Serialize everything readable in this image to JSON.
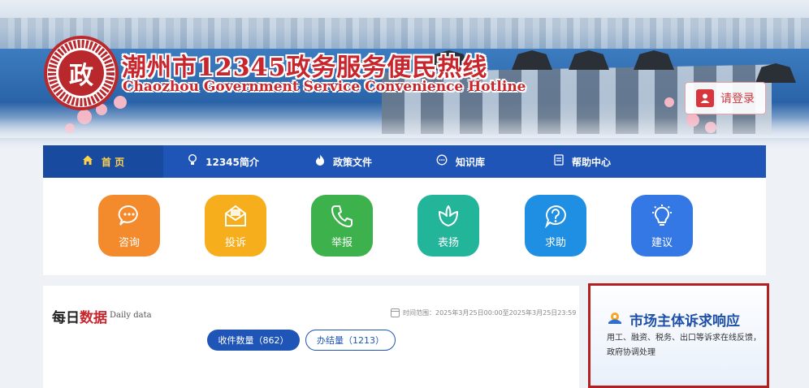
{
  "header": {
    "logo_char": "政",
    "title_cn": "潮州市12345政务服务便民热线",
    "title_en": "Chaozhou Government Service Convenience Hotline",
    "login_label": "请登录"
  },
  "nav": {
    "items": [
      {
        "label": "首 页",
        "icon": "home-icon",
        "active": true
      },
      {
        "label": "12345简介",
        "icon": "lightbulb-icon"
      },
      {
        "label": "政策文件",
        "icon": "flame-icon"
      },
      {
        "label": "知识库",
        "icon": "chat-icon"
      },
      {
        "label": "帮助中心",
        "icon": "document-icon"
      }
    ],
    "active_color": "#ffd24a",
    "bg_color": "#1f55b6"
  },
  "services": [
    {
      "label": "咨询",
      "icon": "chat-bubble-icon",
      "color": "#f38a2c"
    },
    {
      "label": "投诉",
      "icon": "envelope-icon",
      "color": "#f6ae1d"
    },
    {
      "label": "举报",
      "icon": "phone-icon",
      "color": "#3db24c"
    },
    {
      "label": "表扬",
      "icon": "flower-icon",
      "color": "#23b59a"
    },
    {
      "label": "求助",
      "icon": "question-icon",
      "color": "#1f8fe3"
    },
    {
      "label": "建议",
      "icon": "bulb-icon",
      "color": "#3478e6"
    }
  ],
  "daily": {
    "title_plain": "每日",
    "title_highlight": "数据",
    "subtitle": "Daily data",
    "range": "时间范围：2025年3月25日00:00至2025年3月25日23:59",
    "received": "收件数量（862）",
    "completed": "办结量（1213）"
  },
  "market": {
    "title": "市场主体诉求响应",
    "desc": "用工、融资、税务、出口等诉求在线反馈，政府协调处理"
  }
}
